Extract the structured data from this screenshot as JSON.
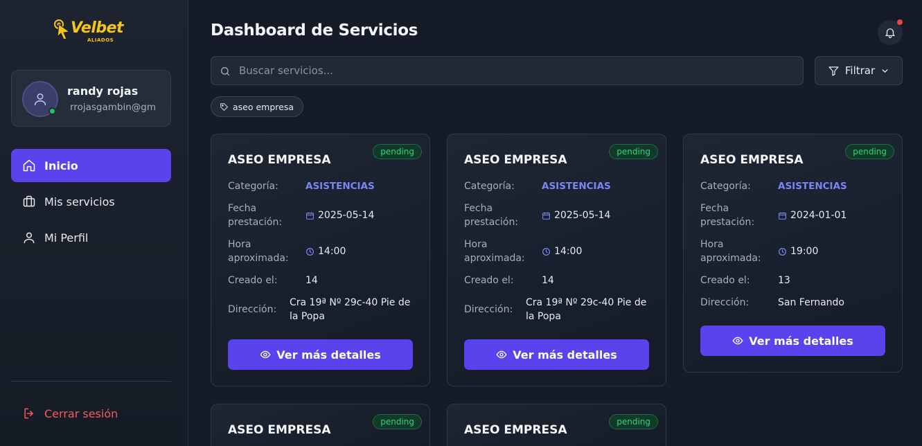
{
  "brand": {
    "name": "Velbet",
    "sub": "ALIADOS",
    "accent": "#5a43ec",
    "logo_color": "#f5c518"
  },
  "user": {
    "name": "randy rojas",
    "email": "rrojasgambin@gm",
    "status": "online"
  },
  "nav": {
    "items": [
      {
        "label": "Inicio",
        "icon": "home-icon",
        "active": true
      },
      {
        "label": "Mis servicios",
        "icon": "briefcase-icon",
        "active": false
      },
      {
        "label": "Mi Perfil",
        "icon": "user-icon",
        "active": false
      }
    ],
    "logout": "Cerrar sesión"
  },
  "header": {
    "title": "Dashboard de Servicios"
  },
  "search": {
    "placeholder": "Buscar servicios...",
    "value": ""
  },
  "filter": {
    "label": "Filtrar"
  },
  "active_filter_chip": "aseo empresa",
  "card_labels": {
    "category": "Categoría:",
    "date": "Fecha prestación:",
    "time": "Hora aproximada:",
    "created": "Creado el:",
    "address": "Dirección:",
    "details_button": "Ver más detalles"
  },
  "cards": [
    {
      "title": "ASEO EMPRESA",
      "status": "pending",
      "category": "ASISTENCIAS",
      "date": "2025-05-14",
      "time": "14:00",
      "created": "14",
      "address": "Cra 19ª Nº 29c-40 Pie de la Popa"
    },
    {
      "title": "ASEO EMPRESA",
      "status": "pending",
      "category": "ASISTENCIAS",
      "date": "2025-05-14",
      "time": "14:00",
      "created": "14",
      "address": "Cra 19ª Nº 29c-40 Pie de la Popa"
    },
    {
      "title": "ASEO EMPRESA",
      "status": "pending",
      "category": "ASISTENCIAS",
      "date": "2024-01-01",
      "time": "19:00",
      "created": "13",
      "address": "San Fernando"
    },
    {
      "title": "ASEO EMPRESA",
      "status": "pending"
    },
    {
      "title": "ASEO EMPRESA",
      "status": "pending"
    }
  ]
}
